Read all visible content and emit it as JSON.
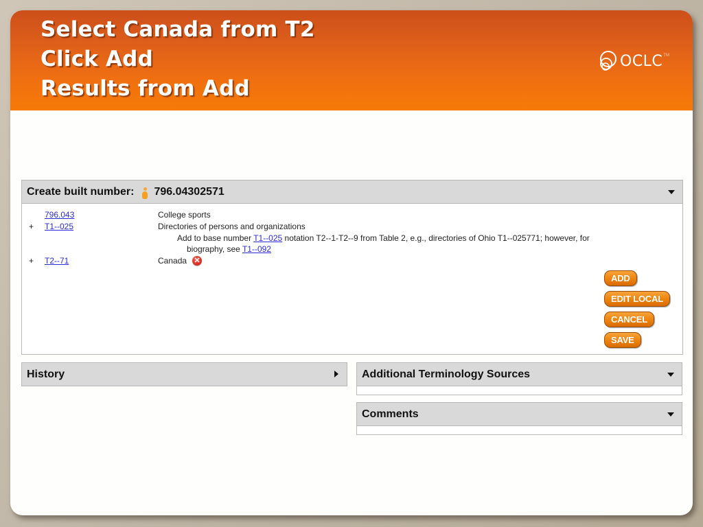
{
  "slide": {
    "title_lines": [
      "Select Canada from T2",
      "Click Add",
      "Results from Add"
    ],
    "logo": {
      "icon": "oclc-rings-icon",
      "text": "OCLC",
      "tm": "TM"
    },
    "colors": {
      "banner": "#f2720f",
      "button": "#ee8510",
      "link": "#2b2bd6",
      "panel_header": "#d9d9d9"
    }
  },
  "builder": {
    "header_label": "Create built number:",
    "info_icon": "info-icon",
    "built_number": "796.04302571",
    "rows": [
      {
        "prefix": "",
        "code": "796.043",
        "description": "College sports"
      },
      {
        "prefix": "+",
        "code": "T1--025",
        "description": "Directories of persons and organizations",
        "note": {
          "text_before": "Add to base number ",
          "link1": "T1--025",
          "text_middle": " notation T2--1-T2--9 from Table 2, e.g., directories of Ohio T1--025771; however, for",
          "text_line2": "biography, see ",
          "link2": "T1--092"
        }
      },
      {
        "prefix": "+",
        "code": "T2--71",
        "description": "Canada",
        "remove_icon": "remove-icon"
      }
    ],
    "buttons": {
      "add": "ADD",
      "edit_local": "EDIT LOCAL",
      "cancel": "CANCEL",
      "save": "SAVE"
    }
  },
  "panels": {
    "history": "History",
    "additional_terminology": "Additional Terminology Sources",
    "comments": "Comments"
  }
}
